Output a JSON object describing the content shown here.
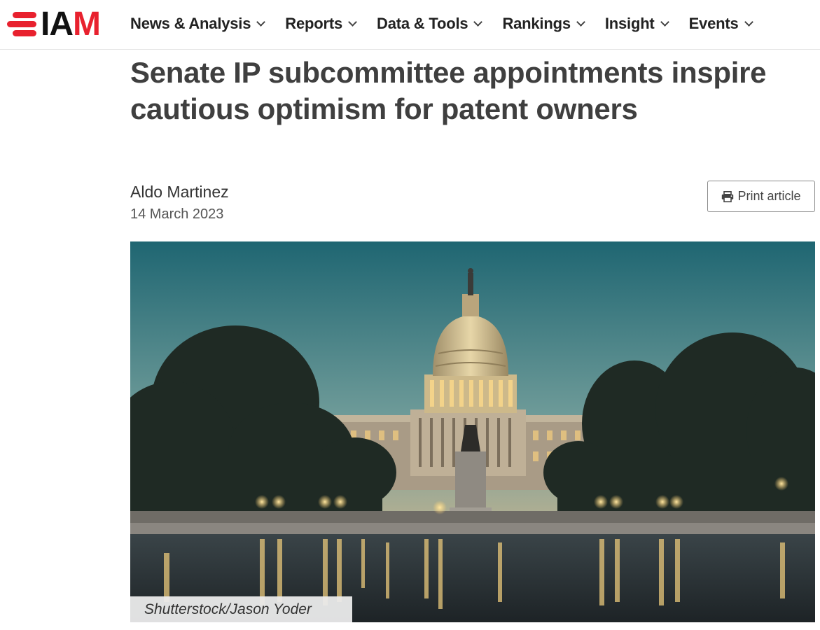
{
  "brand": {
    "logo_text_1": "IA",
    "logo_text_2": "M",
    "accent_color": "#e8212e"
  },
  "nav": {
    "items": [
      {
        "label": "News & Analysis"
      },
      {
        "label": "Reports"
      },
      {
        "label": "Data & Tools"
      },
      {
        "label": "Rankings"
      },
      {
        "label": "Insight"
      },
      {
        "label": "Events"
      }
    ]
  },
  "article": {
    "title": "Senate IP subcommittee appointments inspire cautious optimism for patent owners",
    "author": "Aldo Martinez",
    "date": "14 March 2023",
    "print_label": "Print article",
    "image_credit": "Shutterstock/Jason Yoder"
  },
  "icons": {
    "print": "printer-icon",
    "nav_chevron": "chevron-down-icon"
  }
}
